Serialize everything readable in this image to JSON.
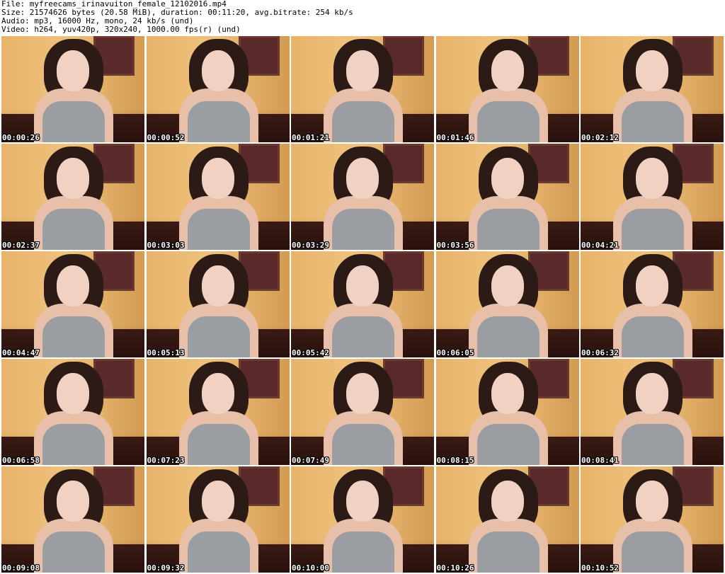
{
  "header": {
    "file_line": "File: myfreecams_irinavuiton_female_12102016.mp4",
    "size_line": "Size: 21574626 bytes (20.58 MiB), duration: 00:11:20, avg.bitrate: 254 kb/s",
    "audio_line": "Audio: mp3, 16000 Hz, mono, 24 kb/s (und)",
    "video_line": "Video: h264, yuv420p, 320x240, 1000.00 fps(r) (und)"
  },
  "thumbnails": [
    {
      "timestamp": "00:00:26"
    },
    {
      "timestamp": "00:00:52"
    },
    {
      "timestamp": "00:01:21"
    },
    {
      "timestamp": "00:01:46"
    },
    {
      "timestamp": "00:02:12"
    },
    {
      "timestamp": "00:02:37"
    },
    {
      "timestamp": "00:03:03"
    },
    {
      "timestamp": "00:03:29"
    },
    {
      "timestamp": "00:03:56"
    },
    {
      "timestamp": "00:04:21"
    },
    {
      "timestamp": "00:04:47"
    },
    {
      "timestamp": "00:05:13"
    },
    {
      "timestamp": "00:05:42"
    },
    {
      "timestamp": "00:06:05"
    },
    {
      "timestamp": "00:06:32"
    },
    {
      "timestamp": "00:06:58"
    },
    {
      "timestamp": "00:07:23"
    },
    {
      "timestamp": "00:07:49"
    },
    {
      "timestamp": "00:08:15"
    },
    {
      "timestamp": "00:08:41"
    },
    {
      "timestamp": "00:09:08"
    },
    {
      "timestamp": "00:09:32"
    },
    {
      "timestamp": "00:10:00"
    },
    {
      "timestamp": "00:10:26"
    },
    {
      "timestamp": "00:10:52"
    }
  ],
  "colors": {
    "background": "#ffffff",
    "header_text": "#000000",
    "timestamp_text": "#ffffff",
    "timestamp_outline": "#000000"
  }
}
